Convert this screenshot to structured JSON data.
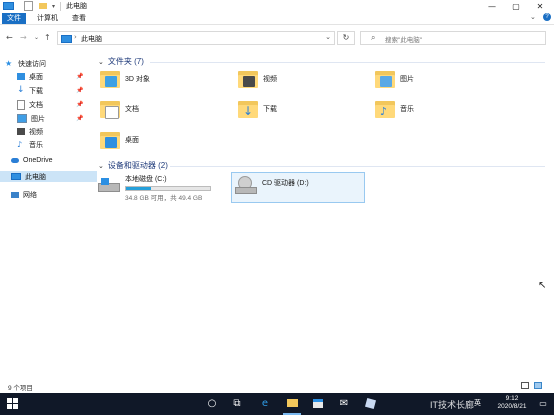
{
  "title": {
    "path_label": "此电脑"
  },
  "window_controls": {
    "minimize": "—",
    "maximize": "▢",
    "close": "✕"
  },
  "ribbon": {
    "tabs": [
      "文件",
      "计算机",
      "查看"
    ]
  },
  "navigation": {
    "address_text": "此电脑",
    "search_placeholder": "搜索\"此电脑\""
  },
  "sidebar": {
    "quick_access": "快速访问",
    "items": [
      {
        "label": "桌面",
        "icon": "desktop-icon",
        "pinned": true
      },
      {
        "label": "下载",
        "icon": "download-icon",
        "pinned": true
      },
      {
        "label": "文档",
        "icon": "documents-icon",
        "pinned": true
      },
      {
        "label": "图片",
        "icon": "pictures-icon",
        "pinned": true
      },
      {
        "label": "视频",
        "icon": "videos-icon",
        "pinned": false
      },
      {
        "label": "音乐",
        "icon": "music-icon",
        "pinned": false
      }
    ],
    "onedrive": "OneDrive",
    "this_pc": "此电脑",
    "network": "网络"
  },
  "main": {
    "folders_header": "文件夹 (7)",
    "folders": [
      {
        "label": "3D 对象",
        "icon": "3d-objects-icon"
      },
      {
        "label": "视频",
        "icon": "videos-icon"
      },
      {
        "label": "图片",
        "icon": "pictures-icon"
      },
      {
        "label": "文档",
        "icon": "documents-icon"
      },
      {
        "label": "下载",
        "icon": "download-icon"
      },
      {
        "label": "音乐",
        "icon": "music-icon"
      },
      {
        "label": "桌面",
        "icon": "desktop-icon"
      }
    ],
    "devices_header": "设备和驱动器 (2)",
    "drives": [
      {
        "label": "本地磁盘 (C:)",
        "free_text": "34.8 GB 可用，共 49.4 GB",
        "used_fraction": 0.3
      },
      {
        "label": "CD 驱动器 (D:)"
      }
    ]
  },
  "status": {
    "count_text": "9 个项目"
  },
  "taskbar": {
    "time": "9:12",
    "date": "2020/8/21",
    "ime": "英",
    "watermark": "IT技术长廊",
    "icons": [
      "start-icon",
      "search-icon",
      "task-view-icon",
      "edge-icon",
      "file-explorer-icon",
      "store-icon",
      "mail-icon",
      "app-icon"
    ]
  },
  "colors": {
    "accent": "#1a6fc4",
    "folder": "#ffd97a",
    "taskbar": "#101828",
    "drive_fill": "#26a0da"
  }
}
